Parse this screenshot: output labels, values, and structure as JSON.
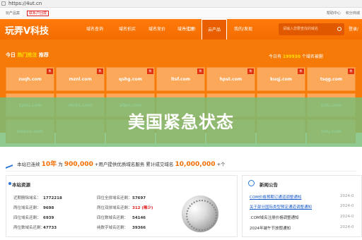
{
  "browser": {
    "url": "https://4ut.cn"
  },
  "topbar": {
    "left_text": "玩产品案",
    "left_badge": "联系户回拨",
    "right_links": [
      "帮助中心",
      "积分商城"
    ]
  },
  "header": {
    "logo": "玩弄V科技",
    "nav": [
      "域名查询",
      "域名拍买",
      "域名竞价",
      "域名注册",
      "一口价",
      "云产品",
      "我的/发现"
    ],
    "search_placeholder": "请输入您要查找的域名",
    "login": "登录/注"
  },
  "hot": {
    "title_prefix": "今日",
    "title_highlight": "热门抢注",
    "title_suffix": "推荐",
    "stat_prefix": "今日有",
    "stat_number": "199930",
    "stat_suffix": "个域名被删",
    "row1": [
      "zuqh.com",
      "mznl.com",
      "qshg.com",
      "ltsf.com",
      "hpst.com",
      "kuqj.com",
      "tsqg.com"
    ],
    "row2": [
      "1pzu.com",
      "mrbs.com",
      "alpu.com",
      "",
      "",
      "",
      "zzlu.com"
    ],
    "row3": [
      "edduo.com",
      "",
      "",
      "",
      "",
      "",
      "umj.com"
    ],
    "tag": "热"
  },
  "overlay": {
    "title": "美国紧急状态"
  },
  "stats": {
    "p1": "本站已连续",
    "n1": "10年",
    "p2": "为",
    "n2": "900,000",
    "p3": "+用户提供优质域名服务 累计成交域名",
    "n3": "10,000,000",
    "p4": "+个"
  },
  "resources": {
    "title": "本站资源",
    "left": [
      {
        "k": "近期删除域名：",
        "v": "1772218"
      },
      {
        "k": "两位域名还剩：",
        "v": "9698"
      },
      {
        "k": "四位域名还剩：",
        "v": "6939"
      },
      {
        "k": "两位数域名还剩：",
        "v": "47733"
      }
    ],
    "right": [
      {
        "k": "四位全拼域名还剩：",
        "v": "57697"
      },
      {
        "k": "两位双拼域名还剩：",
        "v": "312 (稀少)"
      },
      {
        "k": "四位数域名还剩：",
        "v": "54146"
      },
      {
        "k": "纯数字域名还剩：",
        "v": "39366"
      }
    ]
  },
  "news": {
    "title": "新闻公告",
    "items": [
      {
        "text": "COM价格预期订通道调整通知",
        "date": "2024-0"
      },
      {
        "text": "关于部分国际类型预定通道调整通知",
        "date": "2024-0"
      },
      {
        "text": ".COM域名注册价格调整通知",
        "date": "2024-0"
      },
      {
        "text": "2024年端午节放假通知",
        "date": "2024-0"
      }
    ]
  }
}
